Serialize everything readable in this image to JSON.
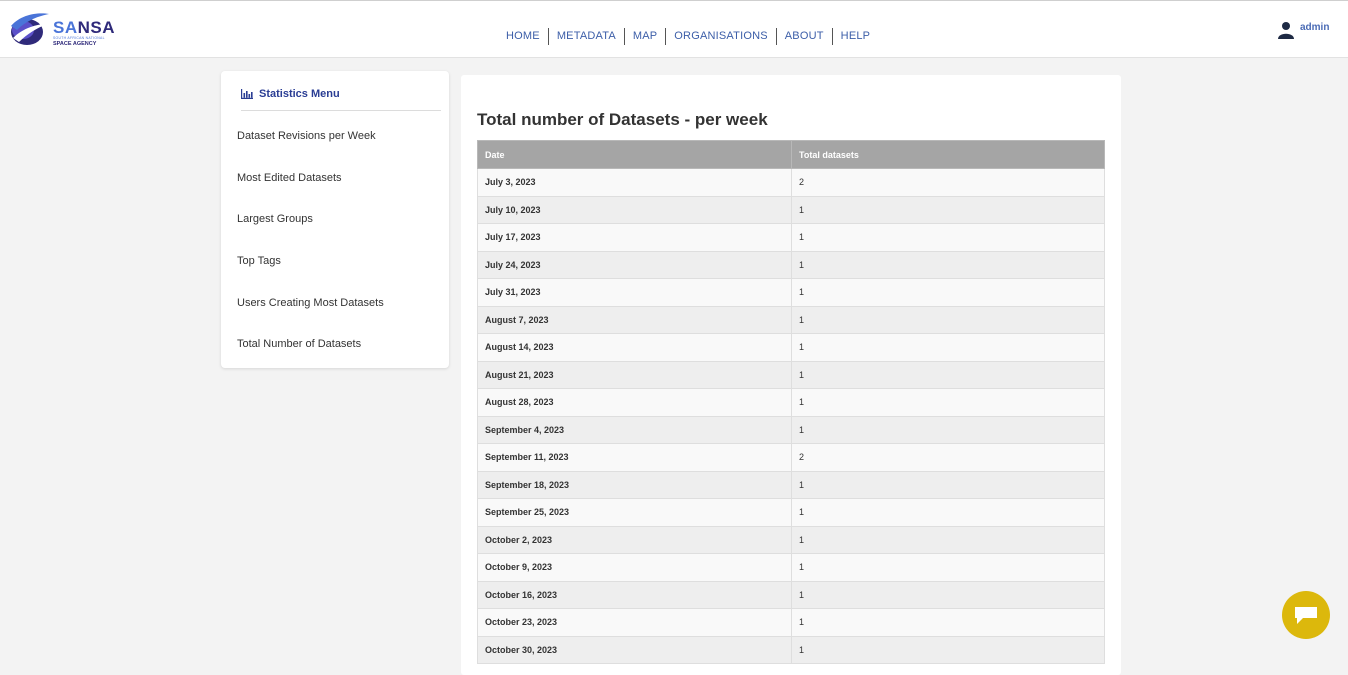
{
  "header": {
    "logo_word_a": "SA",
    "logo_word_b": "NSA",
    "logo_sub": "SOUTH AFRICAN NATIONAL",
    "logo_agency": "SPACE AGENCY",
    "nav": [
      "HOME",
      "METADATA",
      "MAP",
      "ORGANISATIONS",
      "ABOUT",
      "HELP"
    ],
    "user": "admin"
  },
  "sidebar": {
    "title": "Statistics Menu",
    "items": [
      "Dataset Revisions per Week",
      "Most Edited Datasets",
      "Largest Groups",
      "Top Tags",
      "Users Creating Most Datasets",
      "Total Number of Datasets"
    ]
  },
  "main": {
    "title": "Total number of Datasets - per week",
    "columns": [
      "Date",
      "Total datasets"
    ],
    "rows": [
      [
        "July 3, 2023",
        "2"
      ],
      [
        "July 10, 2023",
        "1"
      ],
      [
        "July 17, 2023",
        "1"
      ],
      [
        "July 24, 2023",
        "1"
      ],
      [
        "July 31, 2023",
        "1"
      ],
      [
        "August 7, 2023",
        "1"
      ],
      [
        "August 14, 2023",
        "1"
      ],
      [
        "August 21, 2023",
        "1"
      ],
      [
        "August 28, 2023",
        "1"
      ],
      [
        "September 4, 2023",
        "1"
      ],
      [
        "September 11, 2023",
        "2"
      ],
      [
        "September 18, 2023",
        "1"
      ],
      [
        "September 25, 2023",
        "1"
      ],
      [
        "October 2, 2023",
        "1"
      ],
      [
        "October 9, 2023",
        "1"
      ],
      [
        "October 16, 2023",
        "1"
      ],
      [
        "October 23, 2023",
        "1"
      ],
      [
        "October 30, 2023",
        "1"
      ]
    ]
  },
  "colors": {
    "nav_link": "#3c5ea8",
    "sidebar_title": "#2a3d94",
    "table_header": "#a5a5a5",
    "chat_button": "#dcb80c"
  },
  "icons": {
    "sidebar_title": "bar-chart-icon",
    "user": "user-icon",
    "chat": "chat-bubble-icon"
  }
}
